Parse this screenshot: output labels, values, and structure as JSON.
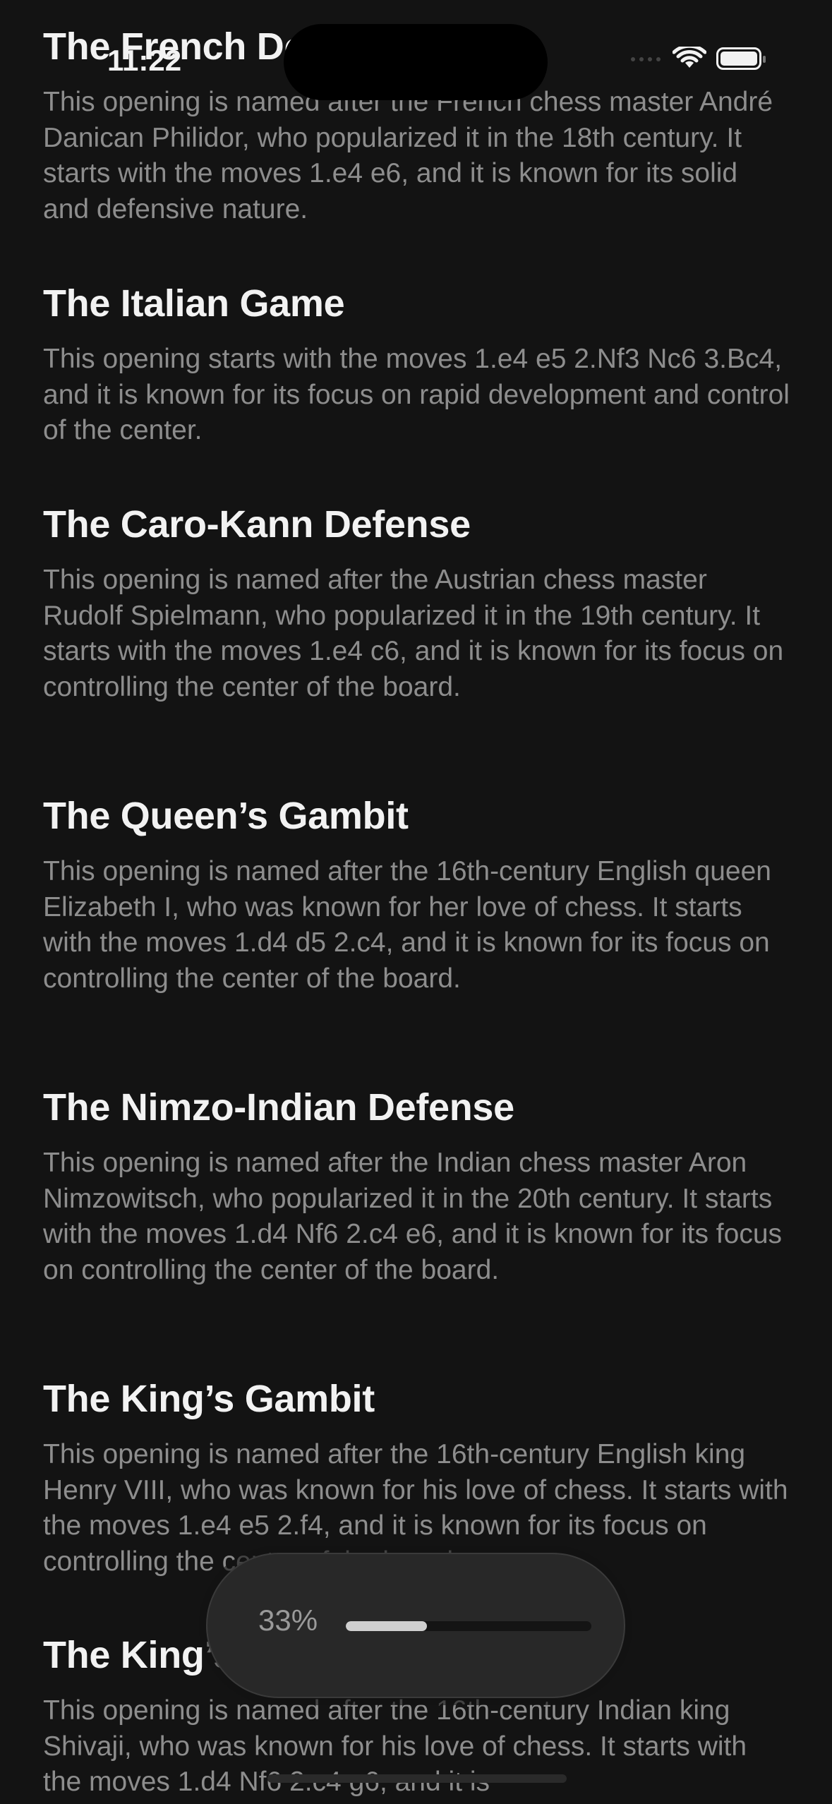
{
  "status_bar": {
    "time": "11:22"
  },
  "sections": [
    {
      "title": "The French Defense",
      "body": "This opening is named after the French chess master André Danican Philidor, who popularized it in the 18th century. It starts with the moves 1.e4 e6, and it is known for its solid and defensive nature."
    },
    {
      "title": "The Italian Game",
      "body": "This opening starts with the moves 1.e4 e5 2.Nf3 Nc6 3.Bc4, and it is known for its focus on rapid development and control of the center."
    },
    {
      "title": "The Caro-Kann Defense",
      "body": "This opening is named after the Austrian chess master Rudolf Spielmann, who popularized it in the 19th century. It starts with the moves 1.e4 c6, and it is known for its focus on controlling the center of the board."
    },
    {
      "title": "The Queen’s Gambit",
      "body": "This opening is named after the 16th-century English queen Elizabeth I, who was known for her love of chess. It starts with the moves 1.d4 d5 2.c4, and it is known for its focus on controlling the center of the board."
    },
    {
      "title": "The Nimzo-Indian Defense",
      "body": "This opening is named after the Indian chess master Aron Nimzowitsch, who popularized it in the 20th century. It starts with the moves 1.d4 Nf6 2.c4 e6, and it is known for its focus on controlling the center of the board."
    },
    {
      "title": "The King’s Gambit",
      "body": "This opening is named after the 16th-century English king Henry VIII, who was known for his love of chess. It starts with the moves 1.e4 e5 2.f4, and it is known for its focus on controlling the center of the board."
    },
    {
      "title": "The King’s Indian Defense",
      "body": "This opening is named after the 16th-century Indian king Shivaji, who was known for his love of chess. It starts with the moves 1.d4 Nf6 2.c4 g6, and it is"
    }
  ],
  "progress": {
    "label": "33%",
    "fraction": 0.33
  },
  "colors": {
    "background": "#131313",
    "heading": "#f2f2f2",
    "body": "#8d8d8d",
    "pill": "#282828"
  }
}
